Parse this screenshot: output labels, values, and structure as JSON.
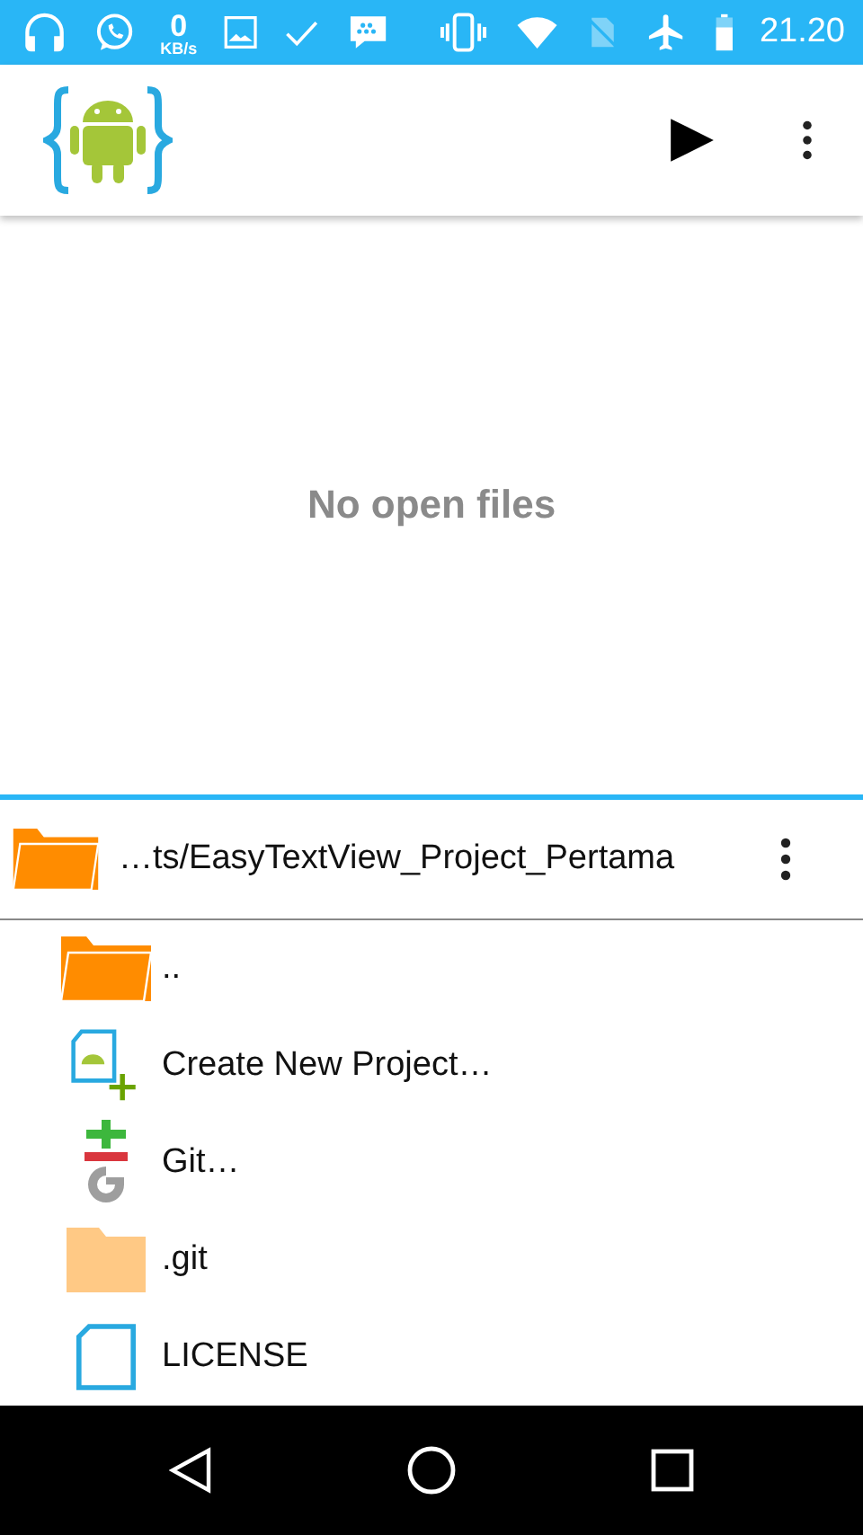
{
  "status_bar": {
    "speed_value": "0",
    "speed_unit": "KB/s",
    "time": "21.20"
  },
  "editor": {
    "empty_message": "No open files"
  },
  "file_browser": {
    "path": "…ts/EasyTextView_Project_Pertama",
    "items": [
      {
        "kind": "folder",
        "label": ".."
      },
      {
        "kind": "new-project",
        "label": "Create New Project…"
      },
      {
        "kind": "git",
        "label": "Git…"
      },
      {
        "kind": "hidden-folder",
        "label": ".git"
      },
      {
        "kind": "file",
        "label": "LICENSE"
      }
    ]
  }
}
